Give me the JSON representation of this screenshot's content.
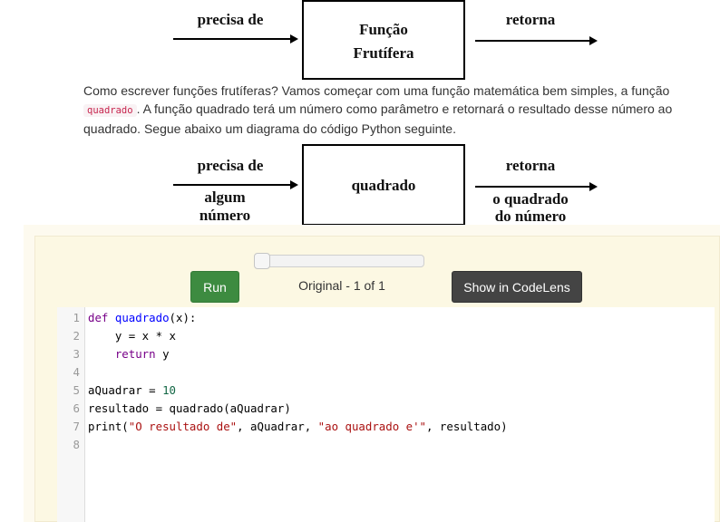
{
  "diagram1": {
    "input_label": "precisa de",
    "box_label": [
      "Função",
      "Frutífera"
    ],
    "output_label": "retorna"
  },
  "paragraph": {
    "part1": "Como escrever funções frutíferas? Vamos começar com uma função matemática bem simples, a função",
    "code": "quadrado",
    "part2": ". A função quadrado terá um número como parâmetro e retornará o resultado desse número ao quadrado. Segue abaixo um diagrama do código Python seguinte."
  },
  "diagram2": {
    "input_label": "precisa de",
    "input_value": [
      "algum",
      "número"
    ],
    "box_label": "quadrado",
    "output_label": "retorna",
    "output_value": [
      "o quadrado",
      "do número"
    ]
  },
  "controls": {
    "run_label": "Run",
    "position_label": "Original - 1 of 1",
    "codelens_label": "Show in CodeLens"
  },
  "code_lines": [
    {
      "n": "1",
      "text": "def quadrado(x):"
    },
    {
      "n": "2",
      "text": "    y = x * x"
    },
    {
      "n": "3",
      "text": "    return y"
    },
    {
      "n": "4",
      "text": ""
    },
    {
      "n": "5",
      "text": "aQuadrar = 10"
    },
    {
      "n": "6",
      "text": "resultado = quadrado(aQuadrar)"
    },
    {
      "n": "7",
      "text": "print(\"O resultado de\", aQuadrar, \"ao quadrado e'\", resultado)"
    },
    {
      "n": "8",
      "text": ""
    }
  ]
}
